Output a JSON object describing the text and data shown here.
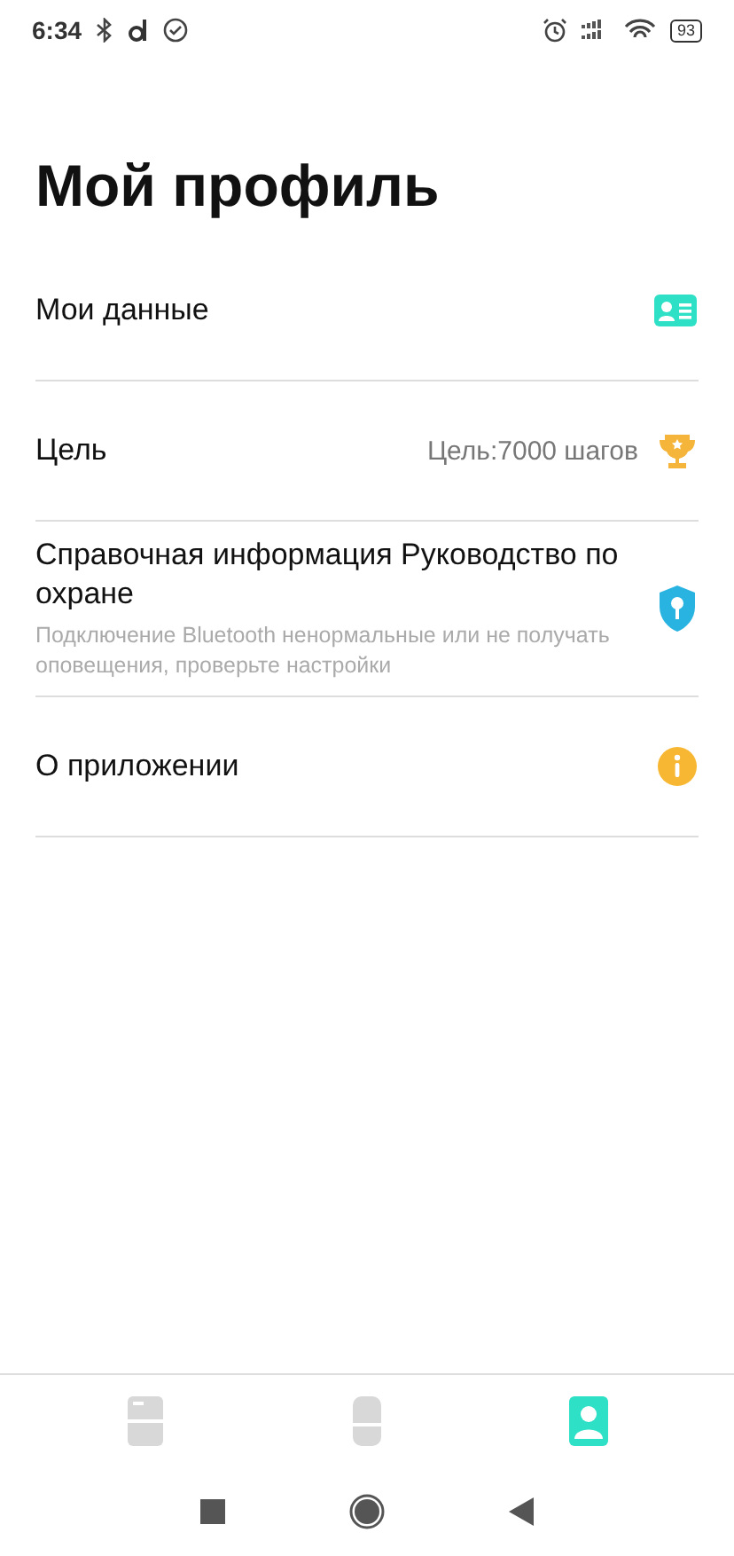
{
  "status_bar": {
    "time": "6:34",
    "battery": "93"
  },
  "title": "Мой профиль",
  "items": [
    {
      "kind": "card",
      "title": "Мои данные"
    },
    {
      "kind": "trophy",
      "title": "Цель",
      "value": "Цель:7000 шагов"
    },
    {
      "kind": "shield",
      "title": "Справочная информация Руководство по охране",
      "subtitle": "Подключение Bluetooth ненормальные или не получать оповещения, проверьте настройки"
    },
    {
      "kind": "info",
      "title": "О приложении"
    }
  ],
  "tabs": [
    {
      "kind": "data",
      "selected": false
    },
    {
      "kind": "watch",
      "selected": false
    },
    {
      "kind": "profile",
      "selected": true
    }
  ]
}
